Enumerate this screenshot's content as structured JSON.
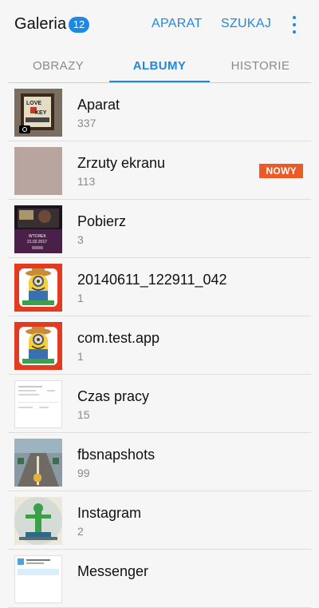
{
  "header": {
    "title": "Galeria",
    "count": "12",
    "camera_label": "APARAT",
    "search_label": "SZUKAJ"
  },
  "tabs": [
    {
      "label": "OBRAZY"
    },
    {
      "label": "ALBUMY"
    },
    {
      "label": "HISTORIE"
    }
  ],
  "albums": [
    {
      "name": "Aparat",
      "count": "337"
    },
    {
      "name": "Zrzuty ekranu",
      "count": "113",
      "badge": "NOWY"
    },
    {
      "name": "Pobierz",
      "count": "3"
    },
    {
      "name": "20140611_122911_042",
      "count": "1"
    },
    {
      "name": "com.test.app",
      "count": "1"
    },
    {
      "name": "Czas pracy",
      "count": "15"
    },
    {
      "name": "fbsnapshots",
      "count": "99"
    },
    {
      "name": "Instagram",
      "count": "2"
    },
    {
      "name": "Messenger",
      "count": ""
    }
  ],
  "thumbnails": {
    "pobierz_text_1": "WTOREK",
    "pobierz_text_2": "21.02.2017"
  },
  "colors": {
    "accent": "#1e88e5",
    "badge_new": "#ee5a26"
  }
}
